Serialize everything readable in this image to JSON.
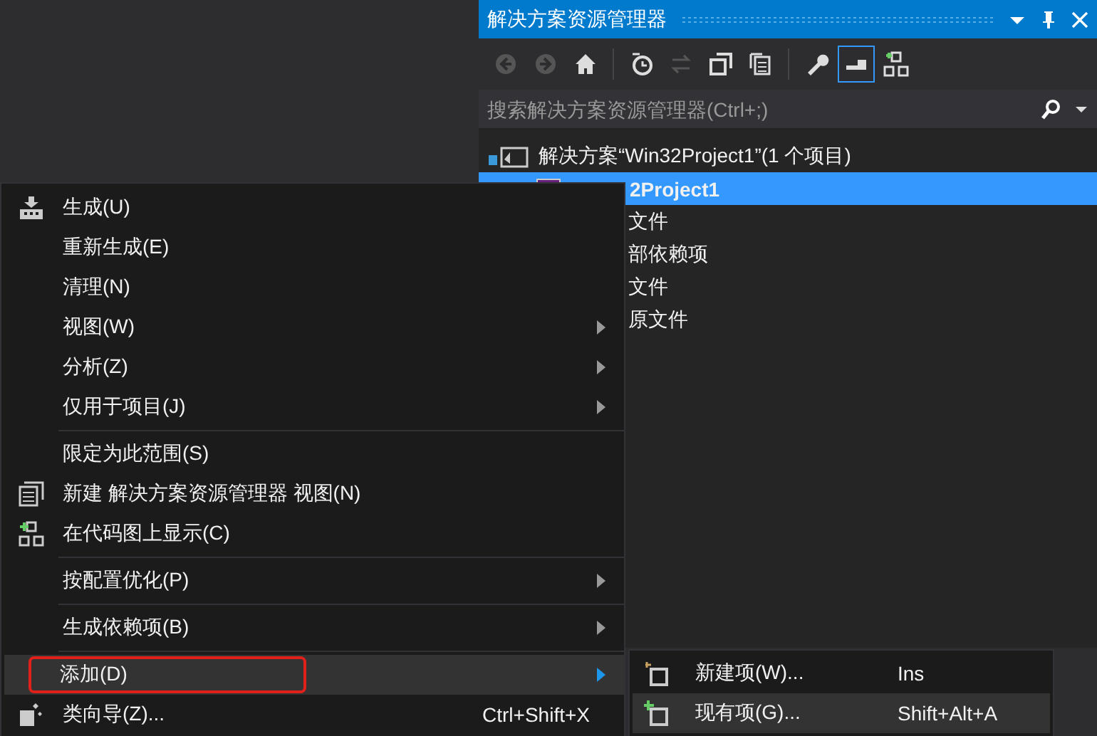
{
  "panel": {
    "title": "解决方案资源管理器",
    "toolbar": [
      {
        "disabled": true,
        "selected": false
      },
      {
        "disabled": true,
        "selected": false
      },
      {
        "disabled": false,
        "selected": false
      },
      {
        "disabled": false,
        "selected": false
      },
      {
        "disabled": true,
        "selected": false
      },
      {
        "disabled": false,
        "selected": false
      },
      {
        "disabled": false,
        "selected": false
      },
      {
        "disabled": false,
        "selected": false
      },
      {
        "disabled": false,
        "selected": true
      },
      {
        "disabled": false,
        "selected": false
      }
    ],
    "search": {
      "placeholder": "搜索解决方案资源管理器(Ctrl+;)"
    },
    "tree": [
      {
        "label": "解决方案“Win32Project1”(1 个项目)",
        "selected": false,
        "children": [
          {
            "label": "2Project1",
            "selected": true,
            "children": [
              {
                "label": "文件",
                "selected": false
              },
              {
                "label": "部依赖项",
                "selected": false
              },
              {
                "label": "文件",
                "selected": false
              },
              {
                "label": "原文件",
                "selected": false
              }
            ]
          }
        ]
      }
    ]
  },
  "context_menu": [
    {
      "kind": "item",
      "label": "生成(U)",
      "submenu": false,
      "selected": false,
      "outlined": false
    },
    {
      "kind": "item",
      "label": "重新生成(E)",
      "submenu": false,
      "selected": false,
      "outlined": false
    },
    {
      "kind": "item",
      "label": "清理(N)",
      "submenu": false,
      "selected": false,
      "outlined": false
    },
    {
      "kind": "item",
      "label": "视图(W)",
      "submenu": true,
      "selected": false,
      "outlined": false
    },
    {
      "kind": "item",
      "label": "分析(Z)",
      "submenu": true,
      "selected": false,
      "outlined": false
    },
    {
      "kind": "item",
      "label": "仅用于项目(J)",
      "submenu": true,
      "selected": false,
      "outlined": false
    },
    {
      "kind": "separator"
    },
    {
      "kind": "item",
      "label": "限定为此范围(S)",
      "submenu": false,
      "selected": false,
      "outlined": false
    },
    {
      "kind": "item",
      "label": "新建 解决方案资源管理器 视图(N)",
      "submenu": false,
      "selected": false,
      "outlined": false
    },
    {
      "kind": "item",
      "label": "在代码图上显示(C)",
      "submenu": false,
      "selected": false,
      "outlined": false
    },
    {
      "kind": "separator"
    },
    {
      "kind": "item",
      "label": "按配置优化(P)",
      "submenu": true,
      "selected": false,
      "outlined": false
    },
    {
      "kind": "separator"
    },
    {
      "kind": "item",
      "label": "生成依赖项(B)",
      "submenu": true,
      "selected": false,
      "outlined": false
    },
    {
      "kind": "separator"
    },
    {
      "kind": "item",
      "label": "添加(D)",
      "submenu": true,
      "selected": true,
      "outlined": true
    },
    {
      "kind": "item",
      "label": "类向导(Z)...",
      "shortcut": "Ctrl+Shift+X",
      "submenu": false,
      "selected": false,
      "outlined": false
    }
  ],
  "submenu": [
    {
      "label": "新建项(W)...",
      "shortcut": "Ins",
      "selected": false
    },
    {
      "label": "现有项(G)...",
      "shortcut": "Shift+Alt+A",
      "selected": true
    }
  ]
}
